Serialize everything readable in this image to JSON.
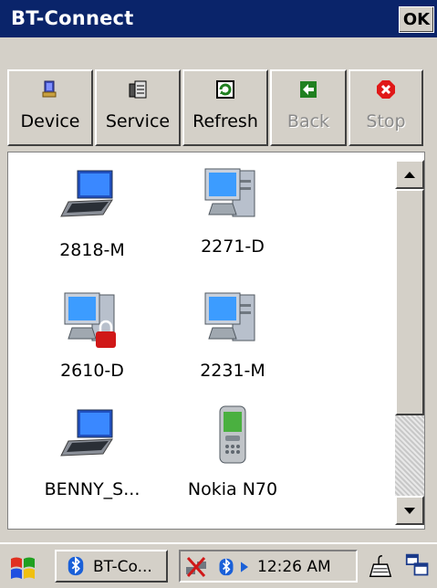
{
  "window": {
    "title": "BT-Connect",
    "ok_label": "OK"
  },
  "toolbar": {
    "buttons": [
      {
        "label": "Device",
        "icon": "device-icon",
        "enabled": true
      },
      {
        "label": "Service",
        "icon": "service-icon",
        "enabled": true
      },
      {
        "label": "Refresh",
        "icon": "refresh-icon",
        "enabled": true
      },
      {
        "label": "Back",
        "icon": "back-arrow-icon",
        "enabled": false
      },
      {
        "label": "Stop",
        "icon": "stop-icon",
        "enabled": false
      }
    ]
  },
  "devices": [
    {
      "name": "2818-M",
      "icon": "laptop-icon"
    },
    {
      "name": "2271-D",
      "icon": "desktop-computer-icon"
    },
    {
      "name": "2610-D",
      "icon": "desktop-computer-locked-icon"
    },
    {
      "name": "2231-M",
      "icon": "desktop-computer-icon"
    },
    {
      "name": "BENNY_S...",
      "icon": "laptop-icon"
    },
    {
      "name": "Nokia N70",
      "icon": "mobile-phone-icon"
    }
  ],
  "taskbar": {
    "task_label": "BT-Co...",
    "clock": "12:26 AM"
  },
  "colors": {
    "title_bg": "#0a246a",
    "face": "#d4d0c8"
  }
}
